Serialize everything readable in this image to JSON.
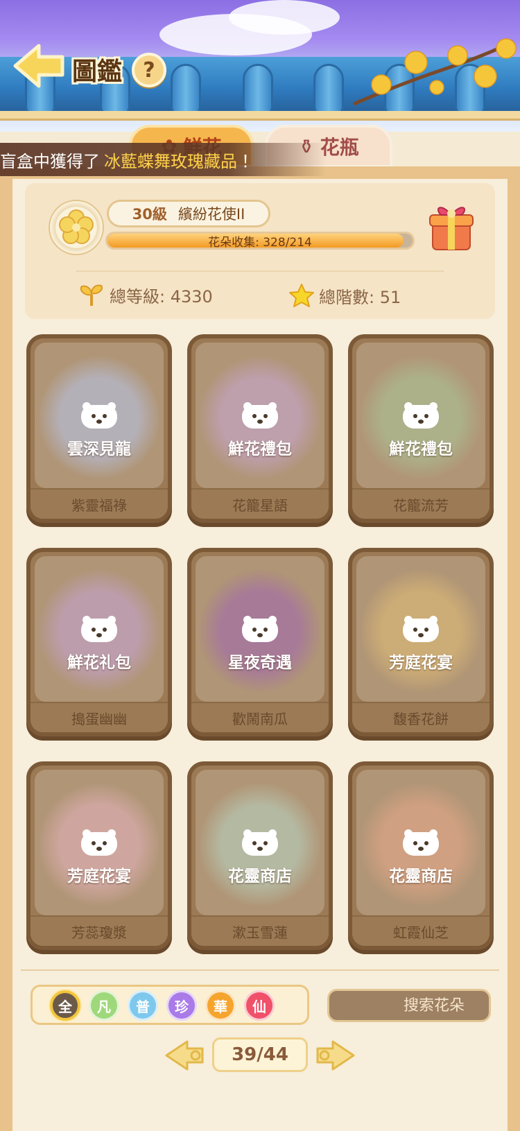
{
  "header": {
    "title": "圖鑑",
    "help_label": "?"
  },
  "tabs": [
    {
      "label": "鮮花",
      "active": true
    },
    {
      "label": "花瓶",
      "active": false
    }
  ],
  "banner": {
    "prefix": "盲盒中獲得了",
    "highlight": "冰藍蝶舞玫瑰藏品",
    "suffix": "！"
  },
  "stats": {
    "level": "30級",
    "rank": "繽紛花使II",
    "collection_label": "花朵收集: 328/214",
    "collection_fill": 0.97,
    "total_level": "總等級: 4330",
    "total_tier": "總階數: 51"
  },
  "cards": [
    {
      "source": "雲深見龍",
      "name": "紫靈福祿",
      "tint": "#b8c6ec"
    },
    {
      "source": "鮮花禮包",
      "name": "花籠星語",
      "tint": "#c9a7d8"
    },
    {
      "source": "鮮花禮包",
      "name": "花籠流芳",
      "tint": "#a9c89a"
    },
    {
      "source": "鮮花礼包",
      "name": "搗蛋幽幽",
      "tint": "#c7a4d8"
    },
    {
      "source": "星夜奇遇",
      "name": "歡鬧南瓜",
      "tint": "#a064b4"
    },
    {
      "source": "芳庭花宴",
      "name": "馥香花餅",
      "tint": "#e3c077"
    },
    {
      "source": "芳庭花宴",
      "name": "芳蕊瓊漿",
      "tint": "#e8b4c0"
    },
    {
      "source": "花靈商店",
      "name": "漱玉雪蓮",
      "tint": "#b8d6c4"
    },
    {
      "source": "花靈商店",
      "name": "虹霞仙芝",
      "tint": "#e9a98a"
    }
  ],
  "filters": [
    {
      "label": "全",
      "color": "#6b5a4a",
      "active": true
    },
    {
      "label": "凡",
      "color": "#9fd87a",
      "active": false
    },
    {
      "label": "普",
      "color": "#7ec8ee",
      "active": false
    },
    {
      "label": "珍",
      "color": "#a97ae8",
      "active": false
    },
    {
      "label": "華",
      "color": "#f5a42e",
      "active": false
    },
    {
      "label": "仙",
      "color": "#f0506a",
      "active": false
    }
  ],
  "search": {
    "placeholder": "搜索花朵"
  },
  "pager": {
    "indicator": "39/44"
  }
}
